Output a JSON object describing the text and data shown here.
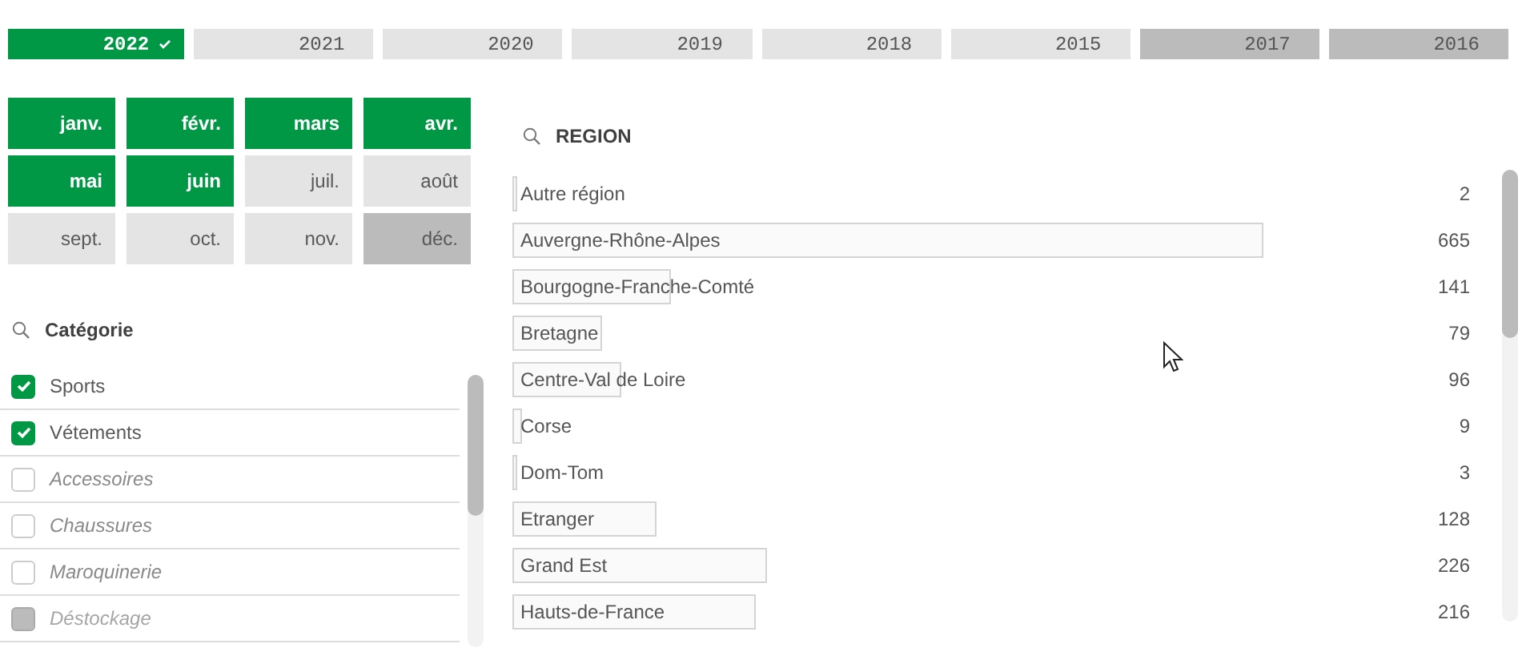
{
  "years": [
    {
      "label": "2022",
      "selected": true,
      "excluded": false
    },
    {
      "label": "2021",
      "selected": false,
      "excluded": false
    },
    {
      "label": "2020",
      "selected": false,
      "excluded": false
    },
    {
      "label": "2019",
      "selected": false,
      "excluded": false
    },
    {
      "label": "2018",
      "selected": false,
      "excluded": false
    },
    {
      "label": "2015",
      "selected": false,
      "excluded": false
    },
    {
      "label": "2017",
      "selected": false,
      "excluded": true
    },
    {
      "label": "2016",
      "selected": false,
      "excluded": true
    }
  ],
  "months": [
    {
      "label": "janv.",
      "selected": true,
      "excluded": false
    },
    {
      "label": "févr.",
      "selected": true,
      "excluded": false
    },
    {
      "label": "mars",
      "selected": true,
      "excluded": false
    },
    {
      "label": "avr.",
      "selected": true,
      "excluded": false
    },
    {
      "label": "mai",
      "selected": true,
      "excluded": false
    },
    {
      "label": "juin",
      "selected": true,
      "excluded": false
    },
    {
      "label": "juil.",
      "selected": false,
      "excluded": false
    },
    {
      "label": "août",
      "selected": false,
      "excluded": false
    },
    {
      "label": "sept.",
      "selected": false,
      "excluded": false
    },
    {
      "label": "oct.",
      "selected": false,
      "excluded": false
    },
    {
      "label": "nov.",
      "selected": false,
      "excluded": false
    },
    {
      "label": "déc.",
      "selected": false,
      "excluded": true
    }
  ],
  "category": {
    "title": "Catégorie",
    "items": [
      {
        "label": "Sports",
        "checked": true,
        "excluded": false
      },
      {
        "label": "Vétements",
        "checked": true,
        "excluded": false
      },
      {
        "label": "Accessoires",
        "checked": false,
        "excluded": false
      },
      {
        "label": "Chaussures",
        "checked": false,
        "excluded": false
      },
      {
        "label": "Maroquinerie",
        "checked": false,
        "excluded": false
      },
      {
        "label": "Déstockage",
        "checked": false,
        "excluded": true
      }
    ]
  },
  "region": {
    "title": "REGION",
    "rows": [
      {
        "label": "Autre région",
        "value": "2"
      },
      {
        "label": "Auvergne-Rhône-Alpes",
        "value": "665"
      },
      {
        "label": "Bourgogne-Franche-Comté",
        "value": "141"
      },
      {
        "label": "Bretagne",
        "value": "79"
      },
      {
        "label": "Centre-Val de Loire",
        "value": "96"
      },
      {
        "label": "Corse",
        "value": "9"
      },
      {
        "label": "Dom-Tom",
        "value": "3"
      },
      {
        "label": "Etranger",
        "value": "128"
      },
      {
        "label": "Grand Est",
        "value": "226"
      },
      {
        "label": "Hauts-de-France",
        "value": "216"
      }
    ]
  }
}
